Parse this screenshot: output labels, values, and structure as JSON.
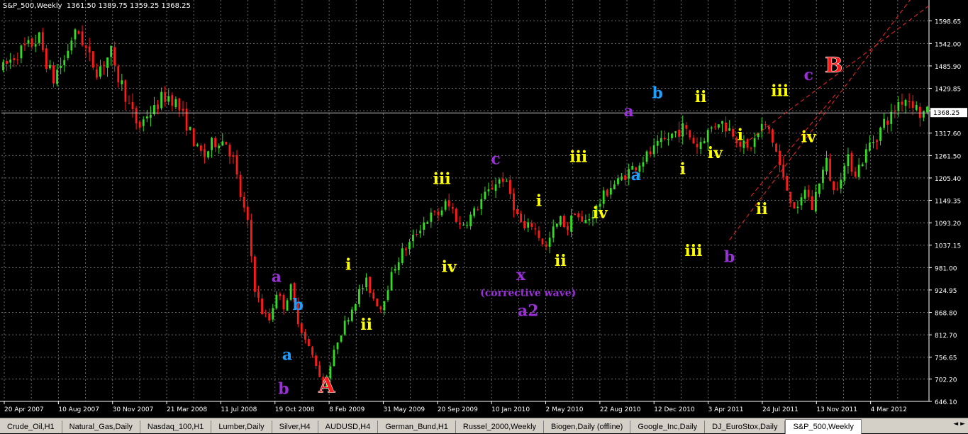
{
  "header": {
    "symbol": "S&P_500,Weekly",
    "ohlc": "1361.50 1389.75 1359.25 1368.25"
  },
  "colors": {
    "background": "#000000",
    "grid": "#6b6b6b",
    "bull": "#33dd22",
    "bear": "#ff1a1a",
    "axis_text": "#ffffff",
    "trendline": "#ff2020",
    "label_yellow": "#ffff00",
    "label_purple": "#9b30d9",
    "label_cyan": "#1e9fff",
    "label_red": "#ff1a1a",
    "violet_text": "#9b30d9"
  },
  "tabs": [
    {
      "label": "Crude_Oil,H1",
      "active": false
    },
    {
      "label": "Natural_Gas,Daily",
      "active": false
    },
    {
      "label": "Nasdaq_100,H1",
      "active": false
    },
    {
      "label": "Lumber,Daily",
      "active": false
    },
    {
      "label": "Silver,H4",
      "active": false
    },
    {
      "label": "AUDUSD,H4",
      "active": false
    },
    {
      "label": "German_Bund,H1",
      "active": false
    },
    {
      "label": "Russel_2000,Weekly",
      "active": false
    },
    {
      "label": "Biogen,Daily (offline)",
      "active": false
    },
    {
      "label": "Google_Inc,Daily",
      "active": false
    },
    {
      "label": "DJ_EuroStox,Daily",
      "active": false
    },
    {
      "label": "S&P_500,Weekly",
      "active": true
    }
  ],
  "chart_data": {
    "type": "candlestick",
    "title": "S&P_500,Weekly",
    "ylim": [
      646.1,
      1626
    ],
    "y_ticks": [
      "1598.65",
      "1542.00",
      "1485.90",
      "1429.85",
      "1373.65",
      "1317.60",
      "1261.50",
      "1205.40",
      "1149.35",
      "1093.20",
      "1037.15",
      "981.00",
      "924.95",
      "868.80",
      "812.70",
      "756.65",
      "702.20",
      "646.10"
    ],
    "current_price": "1368.25",
    "x_ticks": [
      "20 Apr 2007",
      "10 Aug 2007",
      "30 Nov 2007",
      "21 Mar 2008",
      "11 Jul 2008",
      "19 Oct 2008",
      "8 Feb 2009",
      "31 May 2009",
      "20 Sep 2009",
      "10 Jan 2010",
      "2 May 2010",
      "22 Aug 2010",
      "12 Dec 2010",
      "3 Apr 2011",
      "24 Jul 2011",
      "13 Nov 2011",
      "4 Mar 2012"
    ],
    "price_path": [
      [
        0,
        1480
      ],
      [
        3,
        1510
      ],
      [
        5,
        1525
      ],
      [
        7,
        1535
      ],
      [
        10,
        1555
      ],
      [
        12,
        1495
      ],
      [
        14,
        1450
      ],
      [
        15,
        1475
      ],
      [
        17,
        1500
      ],
      [
        19,
        1555
      ],
      [
        21,
        1570
      ],
      [
        24,
        1505
      ],
      [
        26,
        1475
      ],
      [
        28,
        1495
      ],
      [
        30,
        1520
      ],
      [
        31,
        1470
      ],
      [
        33,
        1440
      ],
      [
        35,
        1385
      ],
      [
        37,
        1345
      ],
      [
        38,
        1335
      ],
      [
        40,
        1365
      ],
      [
        42,
        1375
      ],
      [
        44,
        1405
      ],
      [
        46,
        1410
      ],
      [
        48,
        1395
      ],
      [
        50,
        1360
      ],
      [
        52,
        1320
      ],
      [
        54,
        1275
      ],
      [
        56,
        1260
      ],
      [
        58,
        1290
      ],
      [
        60,
        1300
      ],
      [
        62,
        1295
      ],
      [
        64,
        1250
      ],
      [
        66,
        1160
      ],
      [
        68,
        1090
      ],
      [
        70,
        930
      ],
      [
        72,
        870
      ],
      [
        74,
        850
      ],
      [
        76,
        920
      ],
      [
        78,
        885
      ],
      [
        80,
        930
      ],
      [
        82,
        850
      ],
      [
        84,
        800
      ],
      [
        86,
        760
      ],
      [
        87,
        740
      ],
      [
        89,
        683
      ],
      [
        91,
        735
      ],
      [
        93,
        800
      ],
      [
        95,
        840
      ],
      [
        97,
        880
      ],
      [
        99,
        920
      ],
      [
        101,
        945
      ],
      [
        103,
        905
      ],
      [
        105,
        880
      ],
      [
        107,
        935
      ],
      [
        109,
        985
      ],
      [
        111,
        1020
      ],
      [
        113,
        1040
      ],
      [
        115,
        1070
      ],
      [
        117,
        1095
      ],
      [
        119,
        1110
      ],
      [
        121,
        1115
      ],
      [
        123,
        1140
      ],
      [
        125,
        1125
      ],
      [
        127,
        1085
      ],
      [
        129,
        1100
      ],
      [
        131,
        1120
      ],
      [
        133,
        1150
      ],
      [
        135,
        1170
      ],
      [
        137,
        1195
      ],
      [
        139,
        1205
      ],
      [
        141,
        1165
      ],
      [
        143,
        1110
      ],
      [
        145,
        1075
      ],
      [
        147,
        1090
      ],
      [
        149,
        1060
      ],
      [
        151,
        1030
      ],
      [
        153,
        1075
      ],
      [
        155,
        1100
      ],
      [
        157,
        1080
      ],
      [
        159,
        1125
      ],
      [
        161,
        1090
      ],
      [
        163,
        1105
      ],
      [
        165,
        1130
      ],
      [
        167,
        1160
      ],
      [
        169,
        1185
      ],
      [
        171,
        1195
      ],
      [
        173,
        1215
      ],
      [
        175,
        1230
      ],
      [
        177,
        1245
      ],
      [
        179,
        1260
      ],
      [
        181,
        1275
      ],
      [
        183,
        1290
      ],
      [
        185,
        1305
      ],
      [
        187,
        1320
      ],
      [
        189,
        1330
      ],
      [
        191,
        1310
      ],
      [
        193,
        1285
      ],
      [
        195,
        1310
      ],
      [
        197,
        1330
      ],
      [
        199,
        1350
      ],
      [
        201,
        1335
      ],
      [
        203,
        1320
      ],
      [
        205,
        1295
      ],
      [
        207,
        1275
      ],
      [
        209,
        1300
      ],
      [
        211,
        1335
      ],
      [
        213,
        1325
      ],
      [
        215,
        1270
      ],
      [
        217,
        1200
      ],
      [
        219,
        1155
      ],
      [
        221,
        1120
      ],
      [
        223,
        1180
      ],
      [
        225,
        1130
      ],
      [
        227,
        1200
      ],
      [
        229,
        1245
      ],
      [
        231,
        1170
      ],
      [
        233,
        1215
      ],
      [
        235,
        1250
      ],
      [
        237,
        1220
      ],
      [
        239,
        1250
      ],
      [
        241,
        1290
      ],
      [
        243,
        1310
      ],
      [
        245,
        1345
      ],
      [
        247,
        1360
      ],
      [
        249,
        1395
      ],
      [
        251,
        1405
      ],
      [
        253,
        1395
      ],
      [
        255,
        1365
      ],
      [
        256,
        1368
      ]
    ],
    "wave_labels": [
      {
        "text": "a",
        "color": "purple",
        "bar": 76,
        "price": 945
      },
      {
        "text": "b",
        "color": "cyan",
        "bar": 82,
        "price": 875
      },
      {
        "text": "a",
        "color": "cyan",
        "bar": 79,
        "price": 750
      },
      {
        "text": "b",
        "color": "purple",
        "bar": 78,
        "price": 665
      },
      {
        "text": "A",
        "color": "red",
        "bar": 90,
        "price": 668
      },
      {
        "text": "i",
        "color": "yellow",
        "bar": 96,
        "price": 975
      },
      {
        "text": "ii",
        "color": "yellow",
        "bar": 101,
        "price": 825
      },
      {
        "text": "iii",
        "color": "yellow",
        "bar": 122,
        "price": 1190
      },
      {
        "text": "iv",
        "color": "yellow",
        "bar": 124,
        "price": 970
      },
      {
        "text": "c",
        "color": "purple",
        "bar": 137,
        "price": 1240
      },
      {
        "text": "x",
        "color": "purple",
        "bar": 144,
        "price": 950
      },
      {
        "text": "(corrective wave)",
        "color": "violet",
        "bar": 146,
        "price": 910
      },
      {
        "text": "a2",
        "color": "violet",
        "bar": 146,
        "price": 860
      },
      {
        "text": "i",
        "color": "yellow",
        "bar": 149,
        "price": 1135
      },
      {
        "text": "ii",
        "color": "yellow",
        "bar": 155,
        "price": 985
      },
      {
        "text": "iii",
        "color": "yellow",
        "bar": 160,
        "price": 1245
      },
      {
        "text": "iv",
        "color": "yellow",
        "bar": 166,
        "price": 1105
      },
      {
        "text": "a",
        "color": "purple",
        "bar": 174,
        "price": 1360
      },
      {
        "text": "a",
        "color": "cyan",
        "bar": 176,
        "price": 1200
      },
      {
        "text": "b",
        "color": "cyan",
        "bar": 182,
        "price": 1405
      },
      {
        "text": "ii",
        "color": "yellow",
        "bar": 194,
        "price": 1395
      },
      {
        "text": "i",
        "color": "yellow",
        "bar": 189,
        "price": 1215
      },
      {
        "text": "iv",
        "color": "yellow",
        "bar": 198,
        "price": 1255
      },
      {
        "text": "iii",
        "color": "yellow",
        "bar": 192,
        "price": 1010
      },
      {
        "text": "b",
        "color": "purple",
        "bar": 202,
        "price": 995
      },
      {
        "text": "i",
        "color": "yellow",
        "bar": 205,
        "price": 1300
      },
      {
        "text": "ii",
        "color": "yellow",
        "bar": 211,
        "price": 1115
      },
      {
        "text": "iii",
        "color": "yellow",
        "bar": 216,
        "price": 1410
      },
      {
        "text": "iv",
        "color": "yellow",
        "bar": 224,
        "price": 1295
      },
      {
        "text": "c",
        "color": "purple",
        "bar": 224,
        "price": 1450
      },
      {
        "text": "B",
        "color": "red",
        "bar": 231,
        "price": 1470
      }
    ],
    "trendlines": [
      {
        "from": [
          202,
          1050
        ],
        "to": [
          258,
          1720
        ]
      },
      {
        "from": [
          206,
          1290
        ],
        "to": [
          258,
          1640
        ]
      },
      {
        "from": [
          208,
          1160
        ],
        "to": [
          232,
          1420
        ]
      }
    ],
    "grid": true
  }
}
